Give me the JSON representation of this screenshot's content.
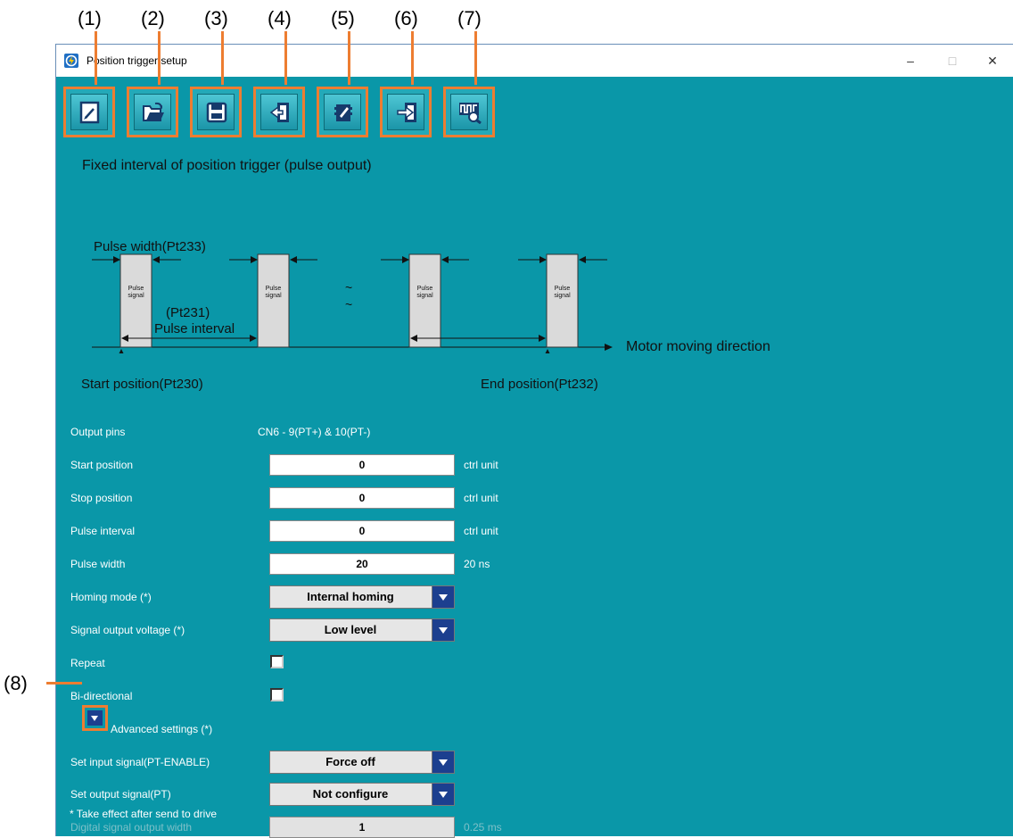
{
  "callouts": [
    "(1)",
    "(2)",
    "(3)",
    "(4)",
    "(5)",
    "(6)",
    "(7)",
    "(8)"
  ],
  "window": {
    "title": "Position trigger setup",
    "minimize": "–",
    "maximize": "□",
    "close": "✕"
  },
  "toolbar": [
    {
      "name": "new-icon"
    },
    {
      "name": "open-folder-icon"
    },
    {
      "name": "save-disk-icon"
    },
    {
      "name": "read-from-drive-icon"
    },
    {
      "name": "write-eeprom-icon"
    },
    {
      "name": "send-to-drive-icon"
    },
    {
      "name": "scope-waveform-icon"
    }
  ],
  "heading": "Fixed interval of position trigger (pulse output)",
  "diagram": {
    "pulse_width": "Pulse width(Pt233)",
    "pulse_signal_line1": "Pulse",
    "pulse_signal_line2": "signal",
    "interval_code": "(Pt231)",
    "interval_label": "Pulse interval",
    "tilde": "~",
    "direction": "Motor moving direction",
    "start": "Start position(Pt230)",
    "end": "End position(Pt232)"
  },
  "form": {
    "output_pins_label": "Output pins",
    "output_pins_value": "CN6 - 9(PT+) & 10(PT-)",
    "start_label": "Start position",
    "start_value": "0",
    "start_unit": "ctrl unit",
    "stop_label": "Stop position",
    "stop_value": "0",
    "stop_unit": "ctrl unit",
    "interval_label": "Pulse interval",
    "interval_value": "0",
    "interval_unit": "ctrl unit",
    "width_label": "Pulse width",
    "width_value": "20",
    "width_unit": "20 ns",
    "homing_label": "Homing mode (*)",
    "homing_value": "Internal homing",
    "voltage_label": "Signal output voltage (*)",
    "voltage_value": "Low level",
    "repeat_label": "Repeat",
    "bidir_label": "Bi-directional",
    "advanced_label": "Advanced settings (*)",
    "input_signal_label": "Set input signal(PT-ENABLE)",
    "input_signal_value": "Force off",
    "output_signal_label": "Set output signal(PT)",
    "output_signal_value": "Not configure",
    "dig_width_label": "Digital signal output width",
    "dig_width_value": "1",
    "dig_width_unit": "0.25 ms",
    "note": "* Take effect after send to drive"
  },
  "colors": {
    "background": "#0a97a8",
    "callout_border": "#ed7d31",
    "dropdown_arrow": "#1c3f8f"
  }
}
